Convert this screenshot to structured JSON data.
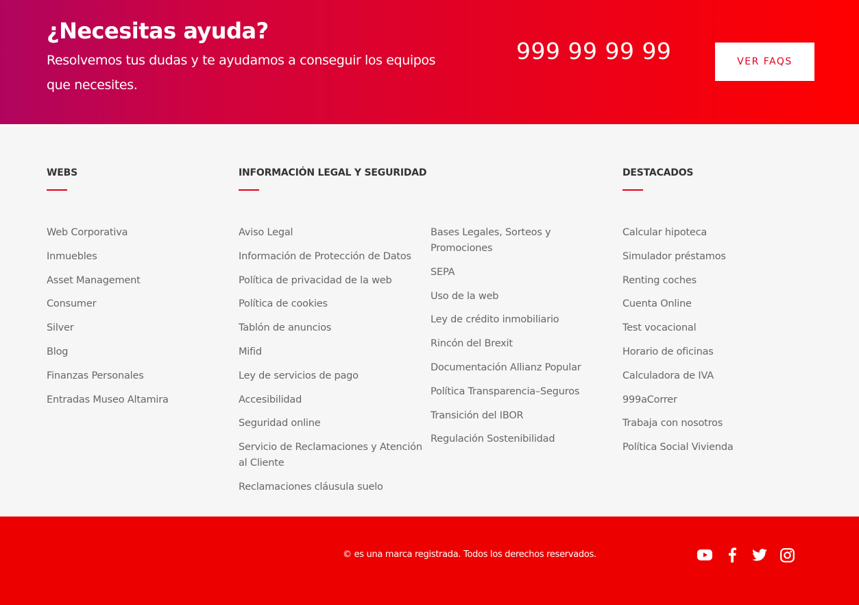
{
  "banner": {
    "title": "¿Necesitas ayuda?",
    "subtitle": "Resolvemos tus dudas y te ayudamos a conseguir los equipos que necesites.",
    "phone": "999 99 99 99",
    "faq_button": "VER FAQS"
  },
  "columns": {
    "webs": {
      "heading": "WEBS",
      "links": [
        "Web Corporativa",
        "Inmuebles",
        "Asset Management",
        "Consumer",
        "Silver",
        "Blog",
        "Finanzas Personales",
        "Entradas Museo Altamira"
      ]
    },
    "legal": {
      "heading": "INFORMACIÓN LEGAL Y SEGURIDAD",
      "links": [
        "Aviso Legal",
        "Información de Protección de Datos",
        "Política de privacidad de la web",
        "Política de cookies",
        "Tablón de anuncios",
        "Mifid",
        "Ley de servicios de pago",
        "Accesibilidad",
        "Seguridad online",
        "Servicio de Reclamaciones y Atención al Cliente",
        "Reclamaciones cláusula suelo"
      ]
    },
    "legal2": {
      "links": [
        "Bases Legales, Sorteos y Promociones",
        "SEPA",
        "Uso de la web",
        "Ley de crédito inmobiliario",
        "Rincón del Brexit",
        "Documentación Allianz Popular",
        "Política Transparencia–Seguros",
        "Transición del IBOR",
        "Regulación Sostenibilidad"
      ]
    },
    "destacados": {
      "heading": "DESTACADOS",
      "links": [
        "Calcular hipoteca",
        "Simulador préstamos",
        "Renting coches",
        "Cuenta Online",
        "Test vocacional",
        "Horario de oficinas",
        "Calculadora de IVA",
        "999aCorrer",
        "Trabaja con nosotros",
        "Política Social Vivienda"
      ]
    }
  },
  "footer": {
    "copyright": "© es una marca registrada. Todos los derechos reservados.",
    "social_icons": [
      "youtube-icon",
      "facebook-icon",
      "twitter-icon",
      "instagram-icon"
    ]
  },
  "colors": {
    "brand_red": "#ec0000",
    "accent_red": "#e0001b",
    "banner_gradient_start": "#b0055f",
    "banner_gradient_end": "#ff0000"
  }
}
